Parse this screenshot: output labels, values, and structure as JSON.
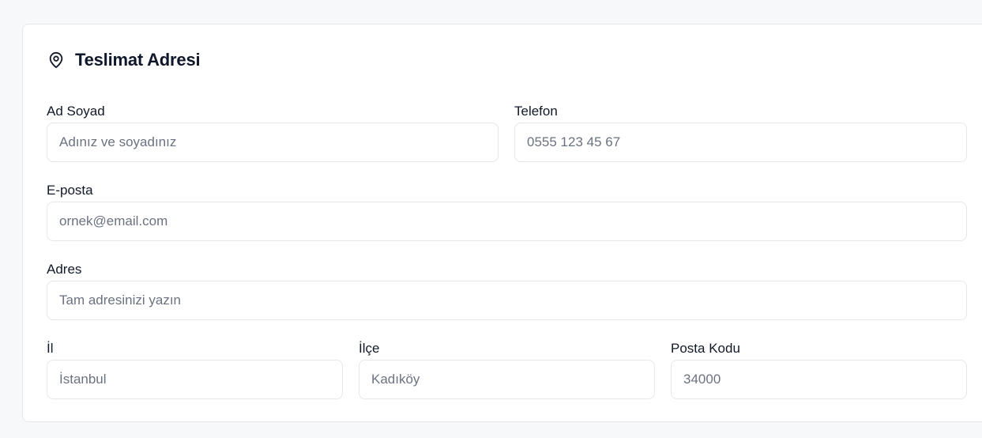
{
  "card": {
    "title": "Teslimat Adresi",
    "icon": "map-pin-icon"
  },
  "fields": {
    "full_name": {
      "label": "Ad Soyad",
      "placeholder": "Adınız ve soyadınız",
      "value": ""
    },
    "phone": {
      "label": "Telefon",
      "placeholder": "0555 123 45 67",
      "value": ""
    },
    "email": {
      "label": "E-posta",
      "placeholder": "ornek@email.com",
      "value": ""
    },
    "address": {
      "label": "Adres",
      "placeholder": "Tam adresinizi yazın",
      "value": ""
    },
    "city": {
      "label": "İl",
      "placeholder": "İstanbul",
      "value": ""
    },
    "district": {
      "label": "İlçe",
      "placeholder": "Kadıköy",
      "value": ""
    },
    "postal_code": {
      "label": "Posta Kodu",
      "placeholder": "34000",
      "value": ""
    }
  },
  "colors": {
    "background": "#f7f8fa",
    "card": "#ffffff",
    "border": "#e5e7eb",
    "text": "#111827",
    "placeholder": "#6b7280"
  }
}
